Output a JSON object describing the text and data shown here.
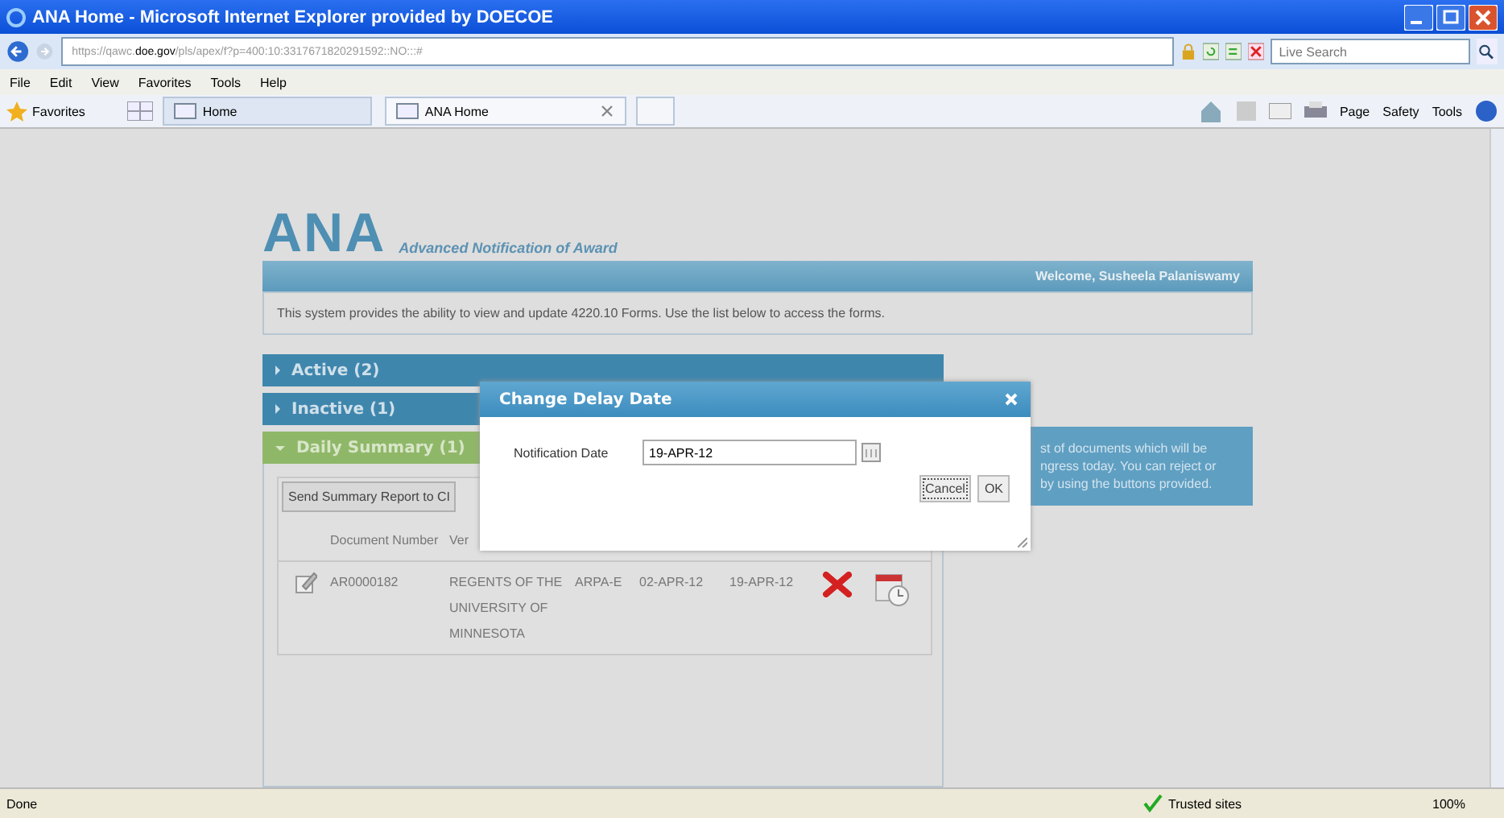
{
  "window": {
    "title": "ANA Home - Microsoft Internet Explorer provided by DOECOE"
  },
  "address": {
    "prefix": "https://qawc.",
    "domain": "doe.gov",
    "path": "/pls/apex/f?p=400:10:3317671820291592::NO:::#"
  },
  "search": {
    "placeholder": "Live Search"
  },
  "menu": [
    "File",
    "Edit",
    "View",
    "Favorites",
    "Tools",
    "Help"
  ],
  "favorites": {
    "label": "Favorites"
  },
  "tabs": [
    {
      "label": "Home",
      "selected": false
    },
    {
      "label": "ANA Home",
      "selected": true
    }
  ],
  "command_bar": [
    "Page",
    "Safety",
    "Tools"
  ],
  "app": {
    "logo": "ANA",
    "subtitle": "Advanced Notification of Award",
    "welcome": "Welcome, Susheela Palaniswamy",
    "intro": "This system provides the ability to view and update 4220.10 Forms. Use the list below to access the forms."
  },
  "sections": [
    {
      "label": "Active (2)",
      "expanded": false
    },
    {
      "label": "Inactive (1)",
      "expanded": false
    },
    {
      "label": "Daily Summary (1)",
      "expanded": true
    }
  ],
  "summary_button": "Send Summary Report to CI",
  "table": {
    "columns": [
      "Document Number",
      "Ver"
    ],
    "rows": [
      {
        "cells": [
          "AR0000182",
          "REGENTS OF THE UNIVERSITY OF MINNESOTA",
          "ARPA-E",
          "02-APR-12",
          "19-APR-12"
        ]
      }
    ]
  },
  "info": [
    "st of documents which will be",
    "ngress today. You can reject or",
    "by using the buttons provided."
  ],
  "dialog": {
    "title": "Change Delay Date",
    "field_label": "Notification Date",
    "value": "19-APR-12",
    "buttons": [
      "Cancel",
      "OK"
    ]
  },
  "status_bar": {
    "text": "Done",
    "zone": "Trusted sites",
    "zoom": "100%"
  }
}
